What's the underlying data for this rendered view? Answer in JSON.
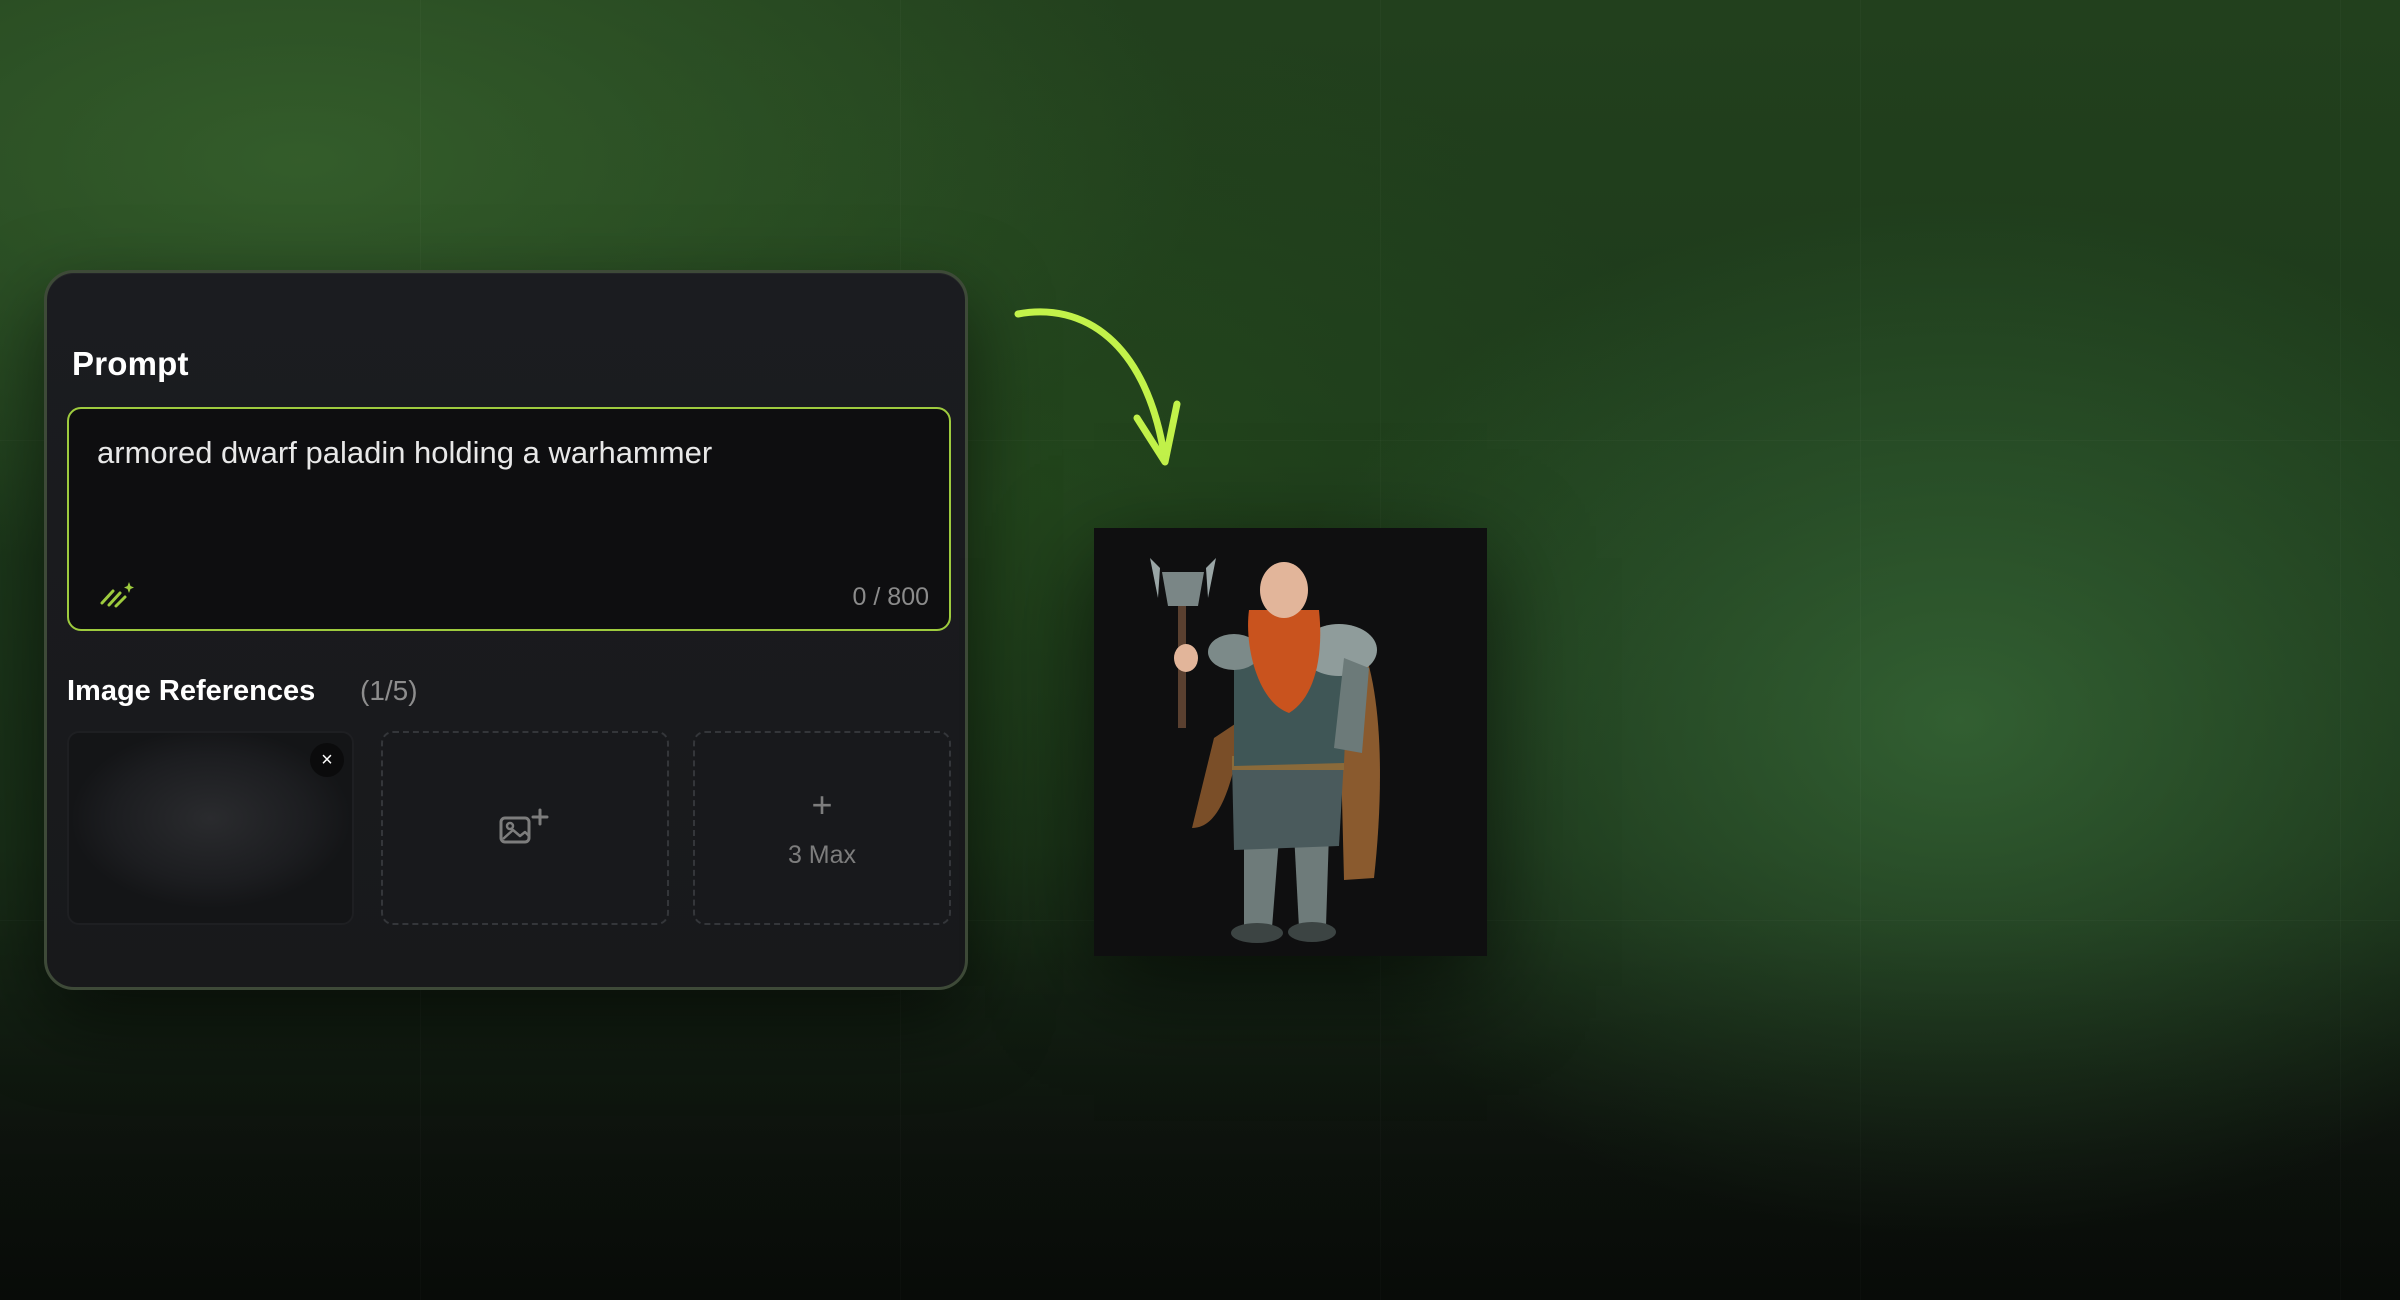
{
  "panel": {
    "prompt_title": "Prompt",
    "prompt_text": "armored dwarf paladin holding a warhammer",
    "char_count": "0 / 800",
    "enhance_icon": "magic-wand-icon",
    "references_title": "Image References",
    "references_count": "(1/5)",
    "remove_label": "×",
    "add_icon": "add-image-icon",
    "max_plus": "+",
    "max_label": "3 Max"
  },
  "output": {
    "image": "armored dwarf paladin with warhammer"
  },
  "colors": {
    "accent": "#9ecb3e",
    "arrow": "#c2f24a",
    "panel_bg": "#1a1b1e",
    "background": "#1f3a1c"
  }
}
